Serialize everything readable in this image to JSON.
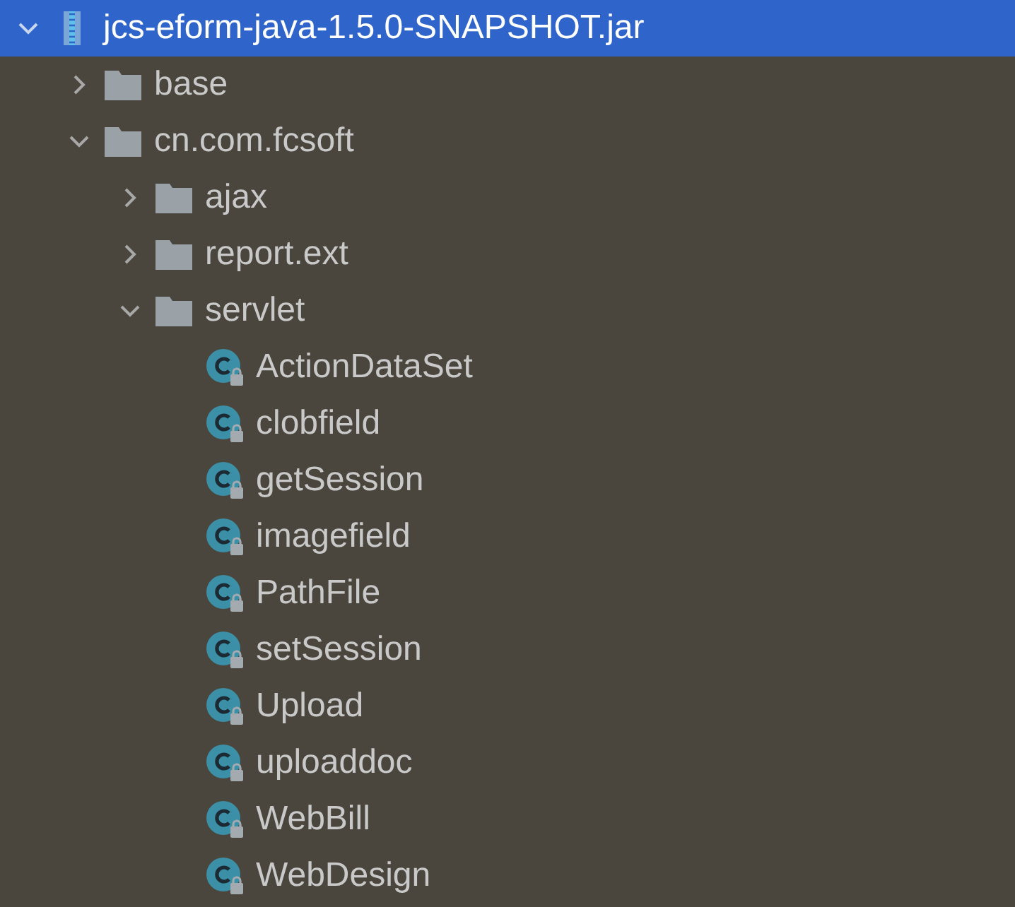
{
  "tree": [
    {
      "kind": "jar",
      "label": "jcs-eform-java-1.5.0-SNAPSHOT.jar",
      "expanded": true,
      "selected": true,
      "children": [
        {
          "kind": "folder",
          "label": "base",
          "expanded": false,
          "selected": false
        },
        {
          "kind": "folder",
          "label": "cn.com.fcsoft",
          "expanded": true,
          "selected": false,
          "children": [
            {
              "kind": "folder",
              "label": "ajax",
              "expanded": false,
              "selected": false
            },
            {
              "kind": "folder",
              "label": "report.ext",
              "expanded": false,
              "selected": false
            },
            {
              "kind": "folder",
              "label": "servlet",
              "expanded": true,
              "selected": false,
              "children": [
                {
                  "kind": "class",
                  "label": "ActionDataSet",
                  "selected": false
                },
                {
                  "kind": "class",
                  "label": "clobfield",
                  "selected": false
                },
                {
                  "kind": "class",
                  "label": "getSession",
                  "selected": false
                },
                {
                  "kind": "class",
                  "label": "imagefield",
                  "selected": false
                },
                {
                  "kind": "class",
                  "label": "PathFile",
                  "selected": false
                },
                {
                  "kind": "class",
                  "label": "setSession",
                  "selected": false
                },
                {
                  "kind": "class",
                  "label": "Upload",
                  "selected": false
                },
                {
                  "kind": "class",
                  "label": "uploaddoc",
                  "selected": false
                },
                {
                  "kind": "class",
                  "label": "WebBill",
                  "selected": false
                },
                {
                  "kind": "class",
                  "label": "WebDesign",
                  "selected": false
                }
              ]
            }
          ]
        }
      ]
    }
  ]
}
